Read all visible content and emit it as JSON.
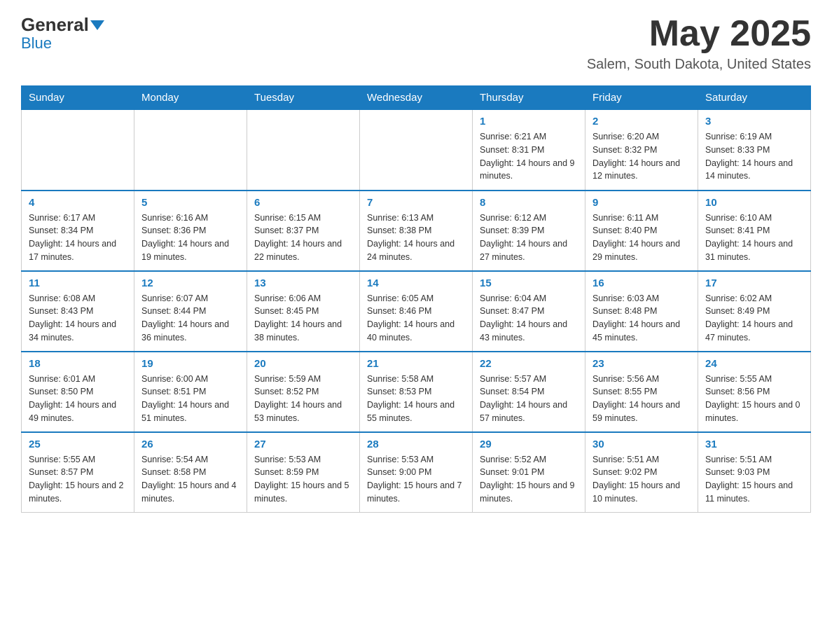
{
  "header": {
    "logo_general": "General",
    "logo_blue": "Blue",
    "month_title": "May 2025",
    "location": "Salem, South Dakota, United States"
  },
  "weekdays": [
    "Sunday",
    "Monday",
    "Tuesday",
    "Wednesday",
    "Thursday",
    "Friday",
    "Saturday"
  ],
  "weeks": [
    [
      {
        "day": "",
        "sunrise": "",
        "sunset": "",
        "daylight": ""
      },
      {
        "day": "",
        "sunrise": "",
        "sunset": "",
        "daylight": ""
      },
      {
        "day": "",
        "sunrise": "",
        "sunset": "",
        "daylight": ""
      },
      {
        "day": "",
        "sunrise": "",
        "sunset": "",
        "daylight": ""
      },
      {
        "day": "1",
        "sunrise": "Sunrise: 6:21 AM",
        "sunset": "Sunset: 8:31 PM",
        "daylight": "Daylight: 14 hours and 9 minutes."
      },
      {
        "day": "2",
        "sunrise": "Sunrise: 6:20 AM",
        "sunset": "Sunset: 8:32 PM",
        "daylight": "Daylight: 14 hours and 12 minutes."
      },
      {
        "day": "3",
        "sunrise": "Sunrise: 6:19 AM",
        "sunset": "Sunset: 8:33 PM",
        "daylight": "Daylight: 14 hours and 14 minutes."
      }
    ],
    [
      {
        "day": "4",
        "sunrise": "Sunrise: 6:17 AM",
        "sunset": "Sunset: 8:34 PM",
        "daylight": "Daylight: 14 hours and 17 minutes."
      },
      {
        "day": "5",
        "sunrise": "Sunrise: 6:16 AM",
        "sunset": "Sunset: 8:36 PM",
        "daylight": "Daylight: 14 hours and 19 minutes."
      },
      {
        "day": "6",
        "sunrise": "Sunrise: 6:15 AM",
        "sunset": "Sunset: 8:37 PM",
        "daylight": "Daylight: 14 hours and 22 minutes."
      },
      {
        "day": "7",
        "sunrise": "Sunrise: 6:13 AM",
        "sunset": "Sunset: 8:38 PM",
        "daylight": "Daylight: 14 hours and 24 minutes."
      },
      {
        "day": "8",
        "sunrise": "Sunrise: 6:12 AM",
        "sunset": "Sunset: 8:39 PM",
        "daylight": "Daylight: 14 hours and 27 minutes."
      },
      {
        "day": "9",
        "sunrise": "Sunrise: 6:11 AM",
        "sunset": "Sunset: 8:40 PM",
        "daylight": "Daylight: 14 hours and 29 minutes."
      },
      {
        "day": "10",
        "sunrise": "Sunrise: 6:10 AM",
        "sunset": "Sunset: 8:41 PM",
        "daylight": "Daylight: 14 hours and 31 minutes."
      }
    ],
    [
      {
        "day": "11",
        "sunrise": "Sunrise: 6:08 AM",
        "sunset": "Sunset: 8:43 PM",
        "daylight": "Daylight: 14 hours and 34 minutes."
      },
      {
        "day": "12",
        "sunrise": "Sunrise: 6:07 AM",
        "sunset": "Sunset: 8:44 PM",
        "daylight": "Daylight: 14 hours and 36 minutes."
      },
      {
        "day": "13",
        "sunrise": "Sunrise: 6:06 AM",
        "sunset": "Sunset: 8:45 PM",
        "daylight": "Daylight: 14 hours and 38 minutes."
      },
      {
        "day": "14",
        "sunrise": "Sunrise: 6:05 AM",
        "sunset": "Sunset: 8:46 PM",
        "daylight": "Daylight: 14 hours and 40 minutes."
      },
      {
        "day": "15",
        "sunrise": "Sunrise: 6:04 AM",
        "sunset": "Sunset: 8:47 PM",
        "daylight": "Daylight: 14 hours and 43 minutes."
      },
      {
        "day": "16",
        "sunrise": "Sunrise: 6:03 AM",
        "sunset": "Sunset: 8:48 PM",
        "daylight": "Daylight: 14 hours and 45 minutes."
      },
      {
        "day": "17",
        "sunrise": "Sunrise: 6:02 AM",
        "sunset": "Sunset: 8:49 PM",
        "daylight": "Daylight: 14 hours and 47 minutes."
      }
    ],
    [
      {
        "day": "18",
        "sunrise": "Sunrise: 6:01 AM",
        "sunset": "Sunset: 8:50 PM",
        "daylight": "Daylight: 14 hours and 49 minutes."
      },
      {
        "day": "19",
        "sunrise": "Sunrise: 6:00 AM",
        "sunset": "Sunset: 8:51 PM",
        "daylight": "Daylight: 14 hours and 51 minutes."
      },
      {
        "day": "20",
        "sunrise": "Sunrise: 5:59 AM",
        "sunset": "Sunset: 8:52 PM",
        "daylight": "Daylight: 14 hours and 53 minutes."
      },
      {
        "day": "21",
        "sunrise": "Sunrise: 5:58 AM",
        "sunset": "Sunset: 8:53 PM",
        "daylight": "Daylight: 14 hours and 55 minutes."
      },
      {
        "day": "22",
        "sunrise": "Sunrise: 5:57 AM",
        "sunset": "Sunset: 8:54 PM",
        "daylight": "Daylight: 14 hours and 57 minutes."
      },
      {
        "day": "23",
        "sunrise": "Sunrise: 5:56 AM",
        "sunset": "Sunset: 8:55 PM",
        "daylight": "Daylight: 14 hours and 59 minutes."
      },
      {
        "day": "24",
        "sunrise": "Sunrise: 5:55 AM",
        "sunset": "Sunset: 8:56 PM",
        "daylight": "Daylight: 15 hours and 0 minutes."
      }
    ],
    [
      {
        "day": "25",
        "sunrise": "Sunrise: 5:55 AM",
        "sunset": "Sunset: 8:57 PM",
        "daylight": "Daylight: 15 hours and 2 minutes."
      },
      {
        "day": "26",
        "sunrise": "Sunrise: 5:54 AM",
        "sunset": "Sunset: 8:58 PM",
        "daylight": "Daylight: 15 hours and 4 minutes."
      },
      {
        "day": "27",
        "sunrise": "Sunrise: 5:53 AM",
        "sunset": "Sunset: 8:59 PM",
        "daylight": "Daylight: 15 hours and 5 minutes."
      },
      {
        "day": "28",
        "sunrise": "Sunrise: 5:53 AM",
        "sunset": "Sunset: 9:00 PM",
        "daylight": "Daylight: 15 hours and 7 minutes."
      },
      {
        "day": "29",
        "sunrise": "Sunrise: 5:52 AM",
        "sunset": "Sunset: 9:01 PM",
        "daylight": "Daylight: 15 hours and 9 minutes."
      },
      {
        "day": "30",
        "sunrise": "Sunrise: 5:51 AM",
        "sunset": "Sunset: 9:02 PM",
        "daylight": "Daylight: 15 hours and 10 minutes."
      },
      {
        "day": "31",
        "sunrise": "Sunrise: 5:51 AM",
        "sunset": "Sunset: 9:03 PM",
        "daylight": "Daylight: 15 hours and 11 minutes."
      }
    ]
  ]
}
